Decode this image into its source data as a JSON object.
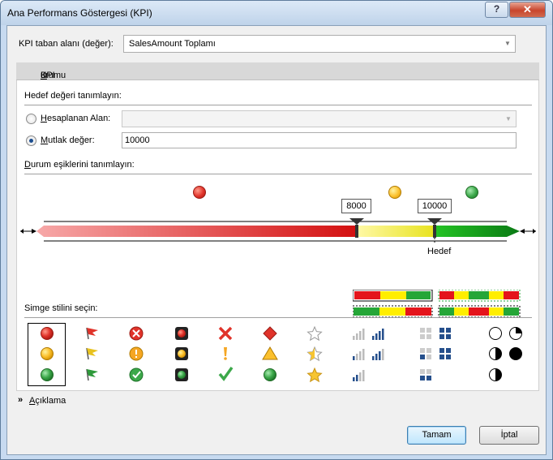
{
  "window": {
    "title": "Ana Performans Göstergesi (KPI)",
    "help_label": "?",
    "close_label": "✕"
  },
  "kpi_base": {
    "label": "KPI taban alanı (değer):",
    "value": "SalesAmount Toplamı"
  },
  "section": {
    "title_prefix": "KPI ",
    "title_accel": "D",
    "title_rest": "urumu"
  },
  "target": {
    "group_label": "Hedef değeri tanımlayın:",
    "calculated": {
      "label_accel": "H",
      "label_rest": "esaplanan Alan:",
      "value": "",
      "checked": false
    },
    "absolute": {
      "label_accel": "M",
      "label_rest": "utlak değer:",
      "value": "10000",
      "checked": true
    }
  },
  "thresholds": {
    "group_label_accel": "D",
    "group_label_rest": "urum eşiklerini tanımlayın:",
    "low_value": "8000",
    "high_value": "10000",
    "target_label": "Hedef",
    "status_colors": {
      "red": "#e0332a",
      "yellow": "#fbc02d",
      "green": "#3ca84a"
    }
  },
  "icon_style": {
    "label_prefix": "Sim",
    "label_accel": "g",
    "label_rest": "e stilini seçin:"
  },
  "icon_sets": [
    {
      "name": "status-circles",
      "icons": [
        "red-circle-icon",
        "yellow-circle-icon",
        "green-circle-icon"
      ],
      "selected": true
    },
    {
      "name": "flags",
      "icons": [
        "red-flag-icon",
        "yellow-flag-icon",
        "green-flag-icon"
      ]
    },
    {
      "name": "circled-symbols",
      "icons": [
        "red-x-circle-icon",
        "yellow-exclamation-circle-icon",
        "green-check-circle-icon"
      ]
    },
    {
      "name": "traffic-lights",
      "icons": [
        "red-light-icon",
        "yellow-light-icon",
        "green-light-icon"
      ]
    },
    {
      "name": "symbols",
      "icons": [
        "red-x-icon",
        "yellow-exclamation-icon",
        "green-check-icon"
      ]
    },
    {
      "name": "shapes",
      "icons": [
        "red-diamond-icon",
        "yellow-triangle-icon",
        "green-circle-icon"
      ]
    },
    {
      "name": "stars",
      "icons": [
        "empty-star-icon",
        "half-star-icon",
        "full-star-icon"
      ]
    },
    {
      "name": "signal-bars",
      "icons": [
        "bars-4-icon",
        "bars-3-icon",
        "bars-2-icon"
      ]
    },
    {
      "name": "quarter-boxes",
      "icons": [
        "boxes-4-icon",
        "boxes-3-icon",
        "boxes-1-icon"
      ]
    },
    {
      "name": "quarter-pies",
      "icons": [
        "pie-empty-icon",
        "pie-half-icon",
        "pie-full-icon"
      ]
    }
  ],
  "description_toggle": {
    "accel": "A",
    "rest": "çıklama"
  },
  "buttons": {
    "ok": "Tamam",
    "cancel": "İptal"
  }
}
